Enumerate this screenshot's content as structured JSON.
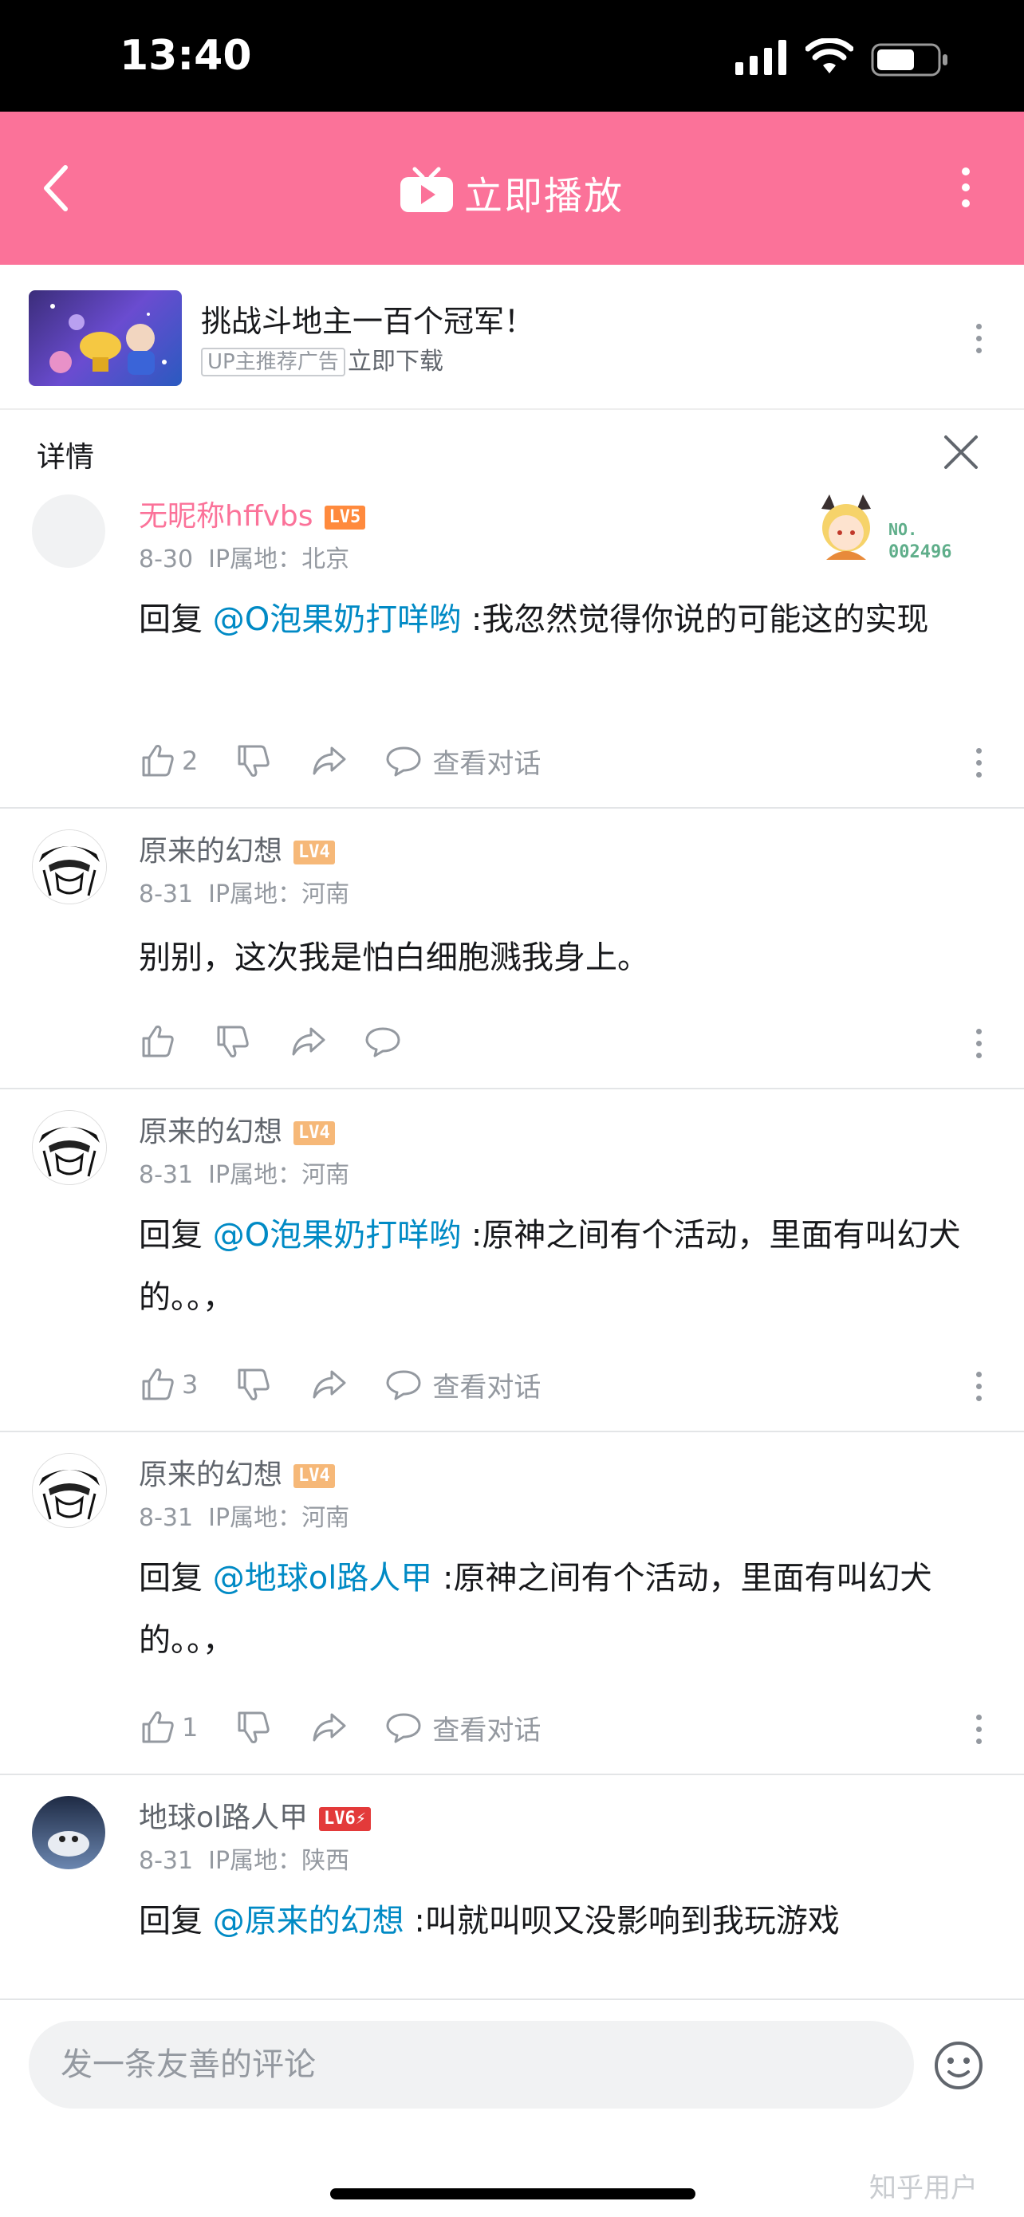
{
  "status": {
    "time": "13:40"
  },
  "nav": {
    "title": "立即播放"
  },
  "ad": {
    "title": "挑战斗地主一百个冠军！",
    "tag": "UP主推荐广告",
    "download": "立即下载"
  },
  "detail": {
    "label": "详情"
  },
  "badge": {
    "no": "NO.",
    "num": "002496"
  },
  "comments": [
    {
      "user": "无昵称hffvbs",
      "level": "LV5",
      "date": "8-30",
      "ip": "IP属地：北京",
      "reply_prefix": "回复 ",
      "reply_to": "@O泡果奶打咩哟",
      "text": " :我忽然觉得你说的可能这的实现",
      "likes": "2",
      "view_conv": "查看对话"
    },
    {
      "user": "原来的幻想",
      "level": "LV4",
      "date": "8-31",
      "ip": "IP属地：河南",
      "text": "别别，这次我是怕白细胞溅我身上。"
    },
    {
      "user": "原来的幻想",
      "level": "LV4",
      "date": "8-31",
      "ip": "IP属地：河南",
      "reply_prefix": "回复 ",
      "reply_to": "@O泡果奶打咩哟",
      "text": " :原神之间有个活动，里面有叫幻犬的。。，",
      "likes": "3",
      "view_conv": "查看对话"
    },
    {
      "user": "原来的幻想",
      "level": "LV4",
      "date": "8-31",
      "ip": "IP属地：河南",
      "reply_prefix": "回复 ",
      "reply_to": "@地球ol路人甲",
      "text": " :原神之间有个活动，里面有叫幻犬的。。，",
      "likes": "1",
      "view_conv": "查看对话"
    },
    {
      "user": "地球ol路人甲",
      "level": "LV6⚡",
      "date": "8-31",
      "ip": "IP属地：陕西",
      "reply_prefix": "回复 ",
      "reply_to": "@原来的幻想",
      "text": " :叫就叫呗又没影响到我玩游戏"
    }
  ],
  "input": {
    "placeholder": "发一条友善的评论"
  },
  "watermark": "知乎用户",
  "colors": {
    "brand_pink": "#fb7299",
    "link_blue": "#008ac5",
    "lv4": "#f6b878",
    "lv5": "#ff8a3d",
    "lv6": "#e33a3a"
  }
}
